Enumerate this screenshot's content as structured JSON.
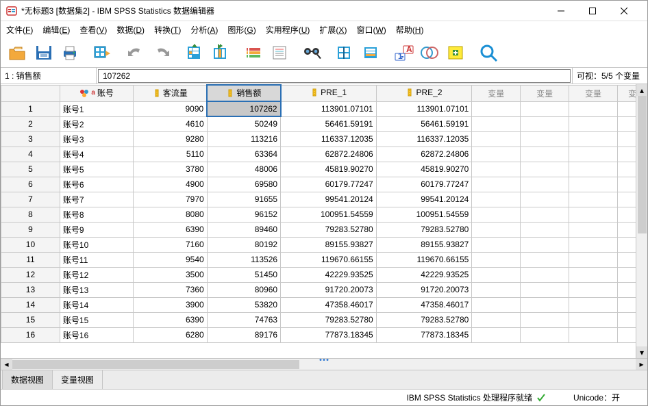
{
  "window": {
    "title": "*无标题3 [数据集2] - IBM SPSS Statistics 数据编辑器"
  },
  "menu": {
    "file": "文件(",
    "file_u": "F",
    "file_e": ")",
    "edit": "编辑(",
    "edit_u": "E",
    "edit_e": ")",
    "view": "查看(",
    "view_u": "V",
    "view_e": ")",
    "data": "数据(",
    "data_u": "D",
    "data_e": ")",
    "trans": "转换(",
    "trans_u": "T",
    "trans_e": ")",
    "anal": "分析(",
    "anal_u": "A",
    "anal_e": ")",
    "graph": "图形(",
    "graph_u": "G",
    "graph_e": ")",
    "util": "实用程序(",
    "util_u": "U",
    "util_e": ")",
    "ext": "扩展(",
    "ext_u": "X",
    "ext_e": ")",
    "win": "窗口(",
    "win_u": "W",
    "win_e": ")",
    "help": "帮助(",
    "help_u": "H",
    "help_e": ")"
  },
  "infobar": {
    "label": "1 : 销售额",
    "value": "107262",
    "right": "可视：5/5 个变量"
  },
  "columns": {
    "acct": "账号",
    "flow": "客流量",
    "sales": "销售额",
    "pre1": "PRE_1",
    "pre2": "PRE_2",
    "var": "变量",
    "var_last": "变"
  },
  "rows": [
    {
      "n": "1",
      "acct": "账号1",
      "flow": "9090",
      "sales": "107262",
      "pre1": "113901.07101",
      "pre2": "113901.07101"
    },
    {
      "n": "2",
      "acct": "账号2",
      "flow": "4610",
      "sales": "50249",
      "pre1": "56461.59191",
      "pre2": "56461.59191"
    },
    {
      "n": "3",
      "acct": "账号3",
      "flow": "9280",
      "sales": "113216",
      "pre1": "116337.12035",
      "pre2": "116337.12035"
    },
    {
      "n": "4",
      "acct": "账号4",
      "flow": "5110",
      "sales": "63364",
      "pre1": "62872.24806",
      "pre2": "62872.24806"
    },
    {
      "n": "5",
      "acct": "账号5",
      "flow": "3780",
      "sales": "48006",
      "pre1": "45819.90270",
      "pre2": "45819.90270"
    },
    {
      "n": "6",
      "acct": "账号6",
      "flow": "4900",
      "sales": "69580",
      "pre1": "60179.77247",
      "pre2": "60179.77247"
    },
    {
      "n": "7",
      "acct": "账号7",
      "flow": "7970",
      "sales": "91655",
      "pre1": "99541.20124",
      "pre2": "99541.20124"
    },
    {
      "n": "8",
      "acct": "账号8",
      "flow": "8080",
      "sales": "96152",
      "pre1": "100951.54559",
      "pre2": "100951.54559"
    },
    {
      "n": "9",
      "acct": "账号9",
      "flow": "6390",
      "sales": "89460",
      "pre1": "79283.52780",
      "pre2": "79283.52780"
    },
    {
      "n": "10",
      "acct": "账号10",
      "flow": "7160",
      "sales": "80192",
      "pre1": "89155.93827",
      "pre2": "89155.93827"
    },
    {
      "n": "11",
      "acct": "账号11",
      "flow": "9540",
      "sales": "113526",
      "pre1": "119670.66155",
      "pre2": "119670.66155"
    },
    {
      "n": "12",
      "acct": "账号12",
      "flow": "3500",
      "sales": "51450",
      "pre1": "42229.93525",
      "pre2": "42229.93525"
    },
    {
      "n": "13",
      "acct": "账号13",
      "flow": "7360",
      "sales": "80960",
      "pre1": "91720.20073",
      "pre2": "91720.20073"
    },
    {
      "n": "14",
      "acct": "账号14",
      "flow": "3900",
      "sales": "53820",
      "pre1": "47358.46017",
      "pre2": "47358.46017"
    },
    {
      "n": "15",
      "acct": "账号15",
      "flow": "6390",
      "sales": "74763",
      "pre1": "79283.52780",
      "pre2": "79283.52780"
    },
    {
      "n": "16",
      "acct": "账号16",
      "flow": "6280",
      "sales": "89176",
      "pre1": "77873.18345",
      "pre2": "77873.18345"
    }
  ],
  "tabs": {
    "data": "数据视图",
    "var": "变量视图"
  },
  "status": {
    "ready": "IBM SPSS Statistics 处理程序就绪",
    "unicode": "Unicode：开"
  }
}
